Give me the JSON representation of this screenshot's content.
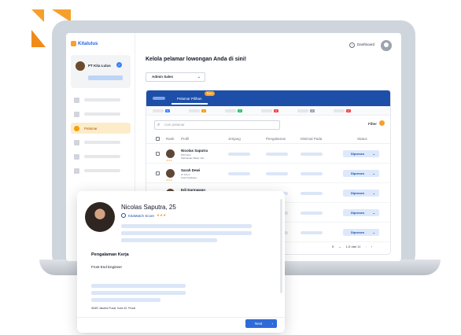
{
  "brand": {
    "name": "Kitalulus",
    "accent": "#1d4fa8",
    "secondary": "#f6a02a"
  },
  "header": {
    "dashboard_label": "Dashboard",
    "dashboard_icon": "help-circle-icon",
    "avatar_icon": "user-icon"
  },
  "sidebar": {
    "company_name": "PT Kita Lulus",
    "active_item_label": "Pelamar"
  },
  "page": {
    "title": "Kelola pelamar lowongan Anda di sini!",
    "job_select_value": "Admin Sales"
  },
  "panel": {
    "tab_label": "Pelamar Pilihan",
    "tab_badge": "Baru",
    "stage_counts": [
      "0",
      "1",
      "0",
      "0",
      "0",
      "0"
    ],
    "stage_colors": [
      "#3b82f6",
      "#f59e0b",
      "#22c55e",
      "#ef4444",
      "#9ca3af",
      "#ef4444"
    ],
    "search_placeholder": "Cari pelamar",
    "filter_label": "Filter"
  },
  "table": {
    "columns": [
      "Rank",
      "Profil",
      "Jenjang",
      "Pengalaman",
      "Minimal Pada",
      "Status"
    ],
    "rows": [
      {
        "name": "Nicolas Saputra",
        "sub1": "PM Intern",
        "sub2": "Kalimantan Barat, Kal...",
        "stars": "★★★",
        "status": "Diproses"
      },
      {
        "name": "Sarah Dewi",
        "sub1": "UI Intern",
        "sub2": "Kota Surabaya",
        "stars": "★★★",
        "status": "Diproses"
      },
      {
        "name": "Edi Darmawan",
        "sub1": "",
        "sub2": "",
        "stars": "",
        "status": "Diproses"
      },
      {
        "name": "",
        "sub1": "",
        "sub2": "",
        "stars": "",
        "status": "Diproses"
      },
      {
        "name": "",
        "sub1": "",
        "sub2": "",
        "stars": "",
        "status": "Diproses"
      }
    ]
  },
  "pagination": {
    "per_page": "5",
    "range": "1-5 dari 11",
    "prev_icon": "chevron-left-icon",
    "next_icon": "chevron-right-icon"
  },
  "card": {
    "name": "Nicolas Saputra, 25",
    "score_label": "KitaMatch Score",
    "score_stars": "★★★",
    "section_title": "Pengalaman Kerja",
    "job_title": "Front End Engineer",
    "education": "SkillS Jakarta Pusat, Kota 40, Pusat",
    "next_label": "Next"
  }
}
